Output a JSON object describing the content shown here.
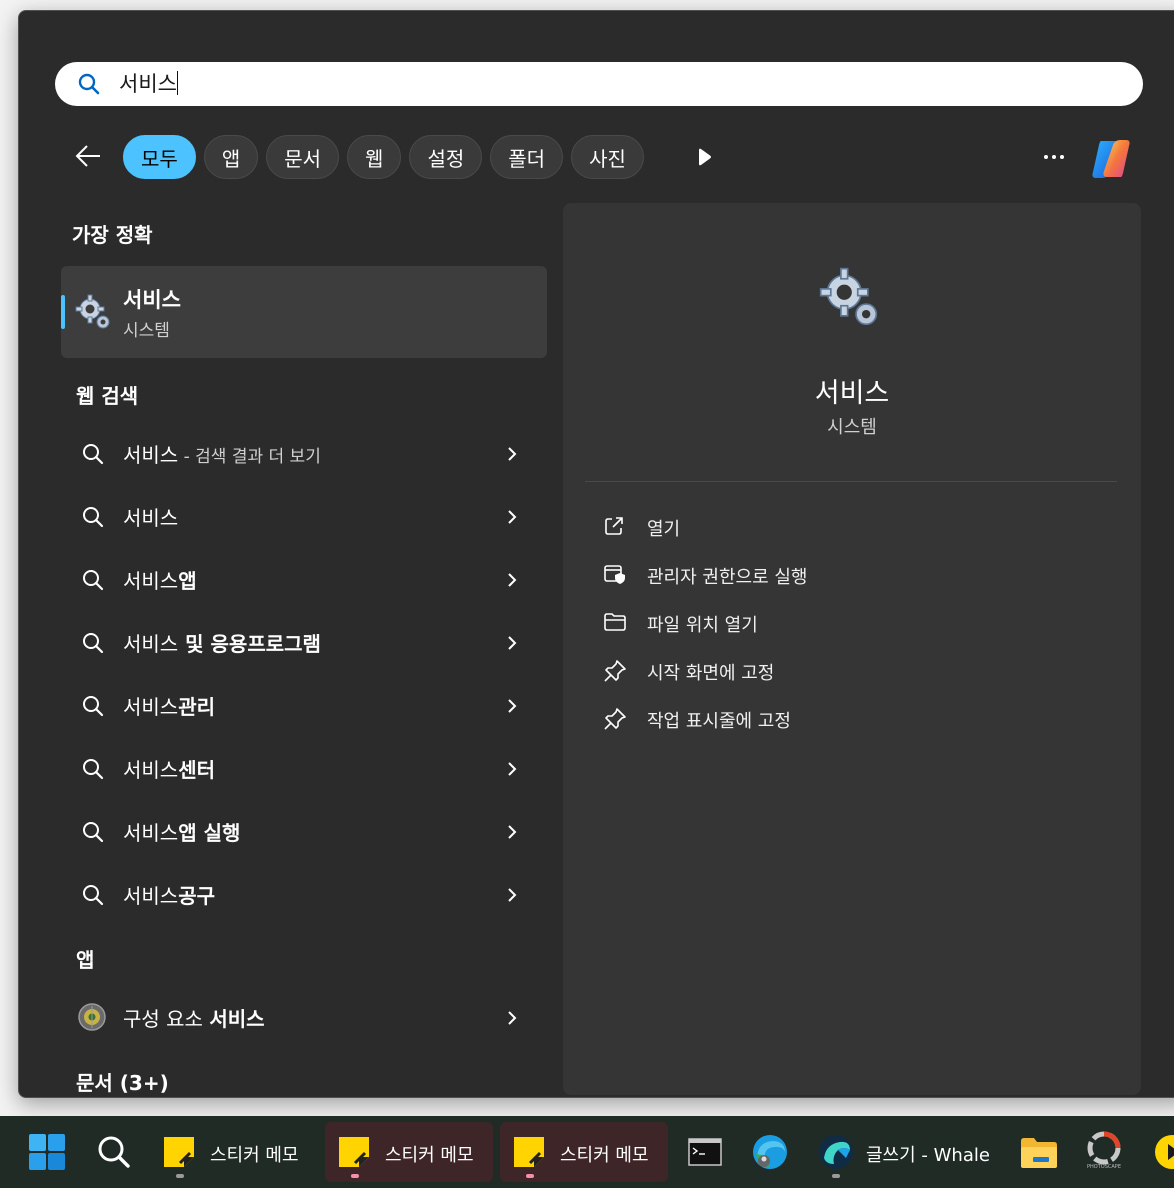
{
  "search": {
    "query": "서비스"
  },
  "filters": [
    {
      "label": "모두",
      "active": true
    },
    {
      "label": "앱"
    },
    {
      "label": "문서"
    },
    {
      "label": "웹"
    },
    {
      "label": "설정"
    },
    {
      "label": "폴더"
    },
    {
      "label": "사진"
    }
  ],
  "best_match": {
    "heading": "가장 정확",
    "title": "서비스",
    "subtitle": "시스템"
  },
  "web": {
    "heading": "웹 검색",
    "items": [
      {
        "prefix": "서비스",
        "suffix": " - 검색 결과 더 보기"
      },
      {
        "prefix": "서비스",
        "suffix": ""
      },
      {
        "prefix": "서비스",
        "suffix": "앱"
      },
      {
        "prefix": "서비스",
        "suffix": " 및 응용프로그램"
      },
      {
        "prefix": "서비스",
        "suffix": "관리"
      },
      {
        "prefix": "서비스",
        "suffix": "센터"
      },
      {
        "prefix": "서비스",
        "suffix": "앱 실행"
      },
      {
        "prefix": "서비스",
        "suffix": "공구"
      }
    ]
  },
  "apps": {
    "heading": "앱",
    "items": [
      {
        "prefix": "구성 요소 ",
        "bold": "서비스"
      }
    ]
  },
  "docs": {
    "heading": "문서 (3+)"
  },
  "detail": {
    "title": "서비스",
    "subtitle": "시스템",
    "actions": [
      {
        "label": "열기",
        "icon": "open-external-icon"
      },
      {
        "label": "관리자 권한으로 실행",
        "icon": "shield-run-icon"
      },
      {
        "label": "파일 위치 열기",
        "icon": "folder-icon"
      },
      {
        "label": "시작 화면에 고정",
        "icon": "pin-icon"
      },
      {
        "label": "작업 표시줄에 고정",
        "icon": "pin-icon"
      }
    ]
  },
  "taskbar": {
    "memo_label": "스티커 메모",
    "whale_label": "글쓰기 - Whale",
    "photoscape_text": "PHOTOSCAPE"
  },
  "colors": {
    "accent": "#4cc2ff",
    "panel": "#2b2b2b",
    "detail": "#353535",
    "selected_row": "#3d3d3d"
  }
}
